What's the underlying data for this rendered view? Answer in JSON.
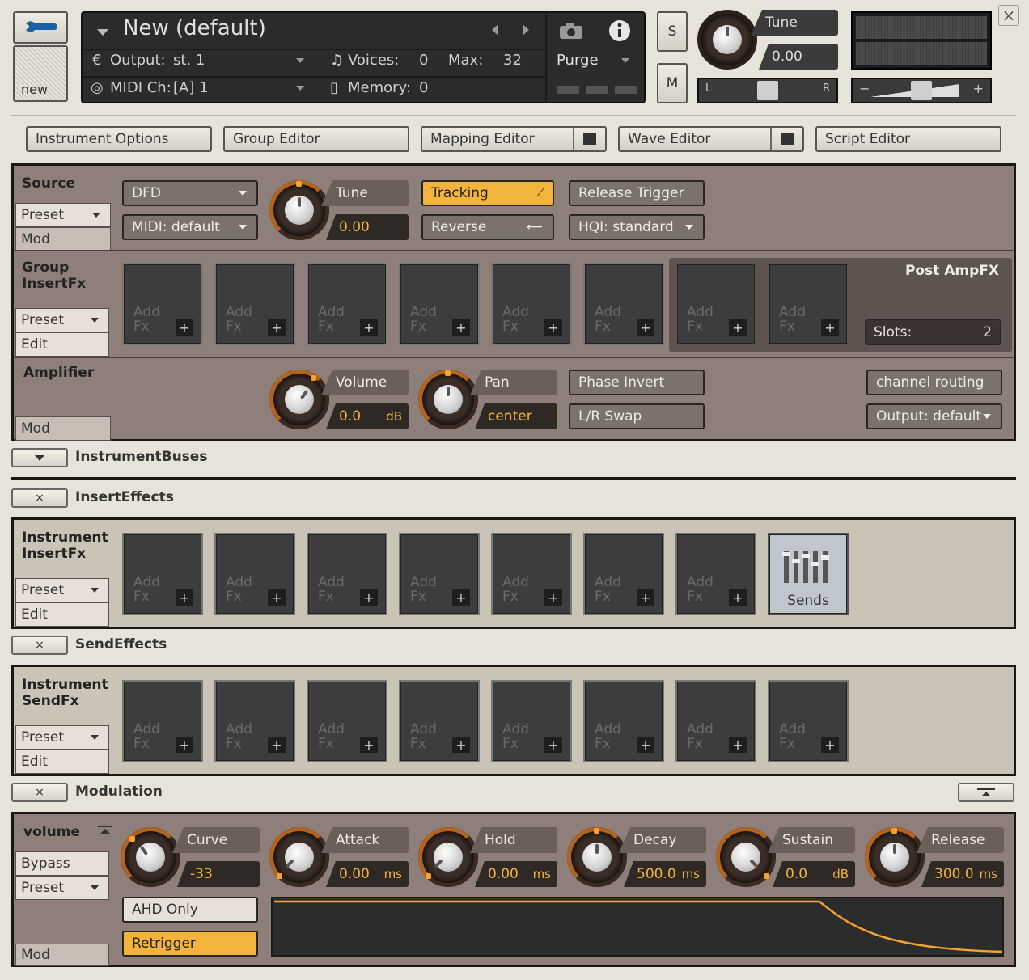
{
  "header": {
    "new_label": "new",
    "instrument_name": "New (default)",
    "output_label": "Output:",
    "output_value": "st. 1",
    "midi_label": "MIDI Ch:",
    "midi_value": "[A]  1",
    "voices_label": "Voices:",
    "voices_value": "0",
    "max_label": "Max:",
    "max_value": "32",
    "memory_label": "Memory:",
    "memory_value": "0",
    "purge_label": "Purge",
    "solo_label": "S",
    "mute_label": "M",
    "tune_label": "Tune",
    "tune_value": "0.00",
    "pan_left": "L",
    "pan_right": "R",
    "vol_minus": "−",
    "vol_plus": "+",
    "close_label": "×"
  },
  "editors": {
    "instrument_options": "Instrument Options",
    "group_editor": "Group Editor",
    "mapping_editor": "Mapping Editor",
    "wave_editor": "Wave Editor",
    "script_editor": "Script Editor"
  },
  "source": {
    "title": "Source",
    "preset": "Preset",
    "mod": "Mod",
    "mode": "DFD",
    "midi": "MIDI: default",
    "tune_label": "Tune",
    "tune_value": "0.00",
    "tracking": "Tracking",
    "reverse": "Reverse",
    "release_trigger": "Release Trigger",
    "hqi": "HQI: standard"
  },
  "group_insert": {
    "title": "Group InsertFx",
    "preset": "Preset",
    "edit": "Edit",
    "post_title": "Post AmpFX",
    "slots_label": "Slots:",
    "slots_value": "2"
  },
  "fx_slot": {
    "line1": "Add",
    "line2": "Fx",
    "plus": "+"
  },
  "amplifier": {
    "title": "Amplifier",
    "mod": "Mod",
    "volume_label": "Volume",
    "volume_value": "0.0",
    "volume_unit": "dB",
    "pan_label": "Pan",
    "pan_value": "center",
    "phase_invert": "Phase Invert",
    "lr_swap": "L/R Swap",
    "channel_routing": "channel routing",
    "output": "Output: default"
  },
  "racks": {
    "instrument_buses": "InstrumentBuses",
    "insert_effects": "InsertEffects",
    "send_effects": "SendEffects",
    "modulation": "Modulation",
    "close": "×"
  },
  "inst_insert": {
    "title": "Instrument InsertFx",
    "preset": "Preset",
    "edit": "Edit",
    "sends": "Sends"
  },
  "inst_send": {
    "title": "Instrument SendFx",
    "preset": "Preset",
    "edit": "Edit"
  },
  "modulation": {
    "target": "volume",
    "bypass": "Bypass",
    "preset": "Preset",
    "mod": "Mod",
    "ahd_only": "AHD Only",
    "retrigger": "Retrigger",
    "params": [
      {
        "label": "Curve",
        "value": "-33",
        "unit": ""
      },
      {
        "label": "Attack",
        "value": "0.00",
        "unit": "ms"
      },
      {
        "label": "Hold",
        "value": "0.00",
        "unit": "ms"
      },
      {
        "label": "Decay",
        "value": "500.0",
        "unit": "ms"
      },
      {
        "label": "Sustain",
        "value": "0.0",
        "unit": "dB"
      },
      {
        "label": "Release",
        "value": "300.0",
        "unit": "ms"
      }
    ]
  },
  "colors": {
    "accent": "#f2b43a",
    "panel_brown": "#8f7f7a",
    "panel_beige": "#c9c4b5"
  }
}
